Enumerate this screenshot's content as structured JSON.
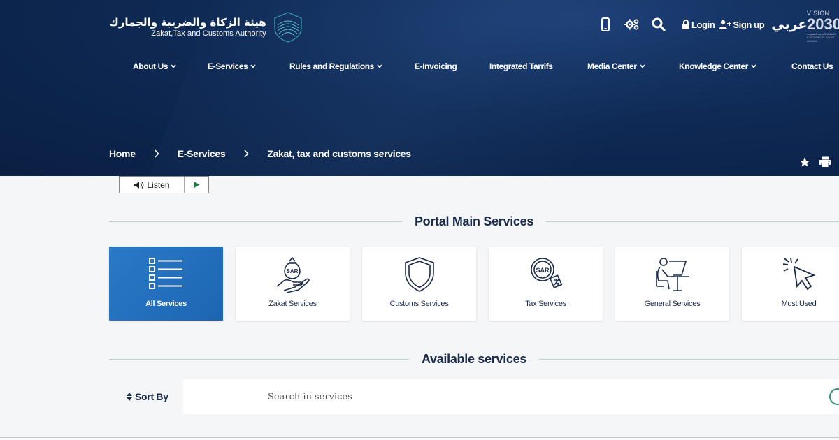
{
  "header": {
    "logo_ar": "هيئة الزكاة والضريبة والجمارك",
    "logo_en": "Zakat,Tax and Customs Authority",
    "login": "Login",
    "signup": "Sign up",
    "language": "عربي",
    "vision_label": "VISION",
    "vision_year": "2030",
    "vision_sub": "المملكة العربية السعودية",
    "vision_sub_en": "KINGDOM OF SAUDI ARABIA"
  },
  "nav": {
    "items": [
      {
        "label": "About Us",
        "dropdown": true
      },
      {
        "label": "E-Services",
        "dropdown": true
      },
      {
        "label": "Rules and Regulations",
        "dropdown": true
      },
      {
        "label": "E-Invoicing",
        "dropdown": false
      },
      {
        "label": "Integrated Tarrifs",
        "dropdown": false
      },
      {
        "label": "Media Center",
        "dropdown": true
      },
      {
        "label": "Knowledge Center",
        "dropdown": true
      },
      {
        "label": "Contact Us",
        "dropdown": false
      }
    ]
  },
  "breadcrumb": [
    "Home",
    "E-Services",
    "Zakat, tax and customs services"
  ],
  "listen": {
    "label": "Listen"
  },
  "portal": {
    "title": "Portal Main Services",
    "cards": [
      {
        "label": "All Services",
        "icon": "list-icon",
        "active": true
      },
      {
        "label": "Zakat Services",
        "icon": "hand-money-bag-icon",
        "active": false
      },
      {
        "label": "Customs Services",
        "icon": "shield-icon",
        "active": false
      },
      {
        "label": "Tax Services",
        "icon": "sar-percent-icon",
        "active": false
      },
      {
        "label": "General Services",
        "icon": "person-desk-icon",
        "active": false
      },
      {
        "label": "Most Used",
        "icon": "cursor-click-icon",
        "active": false
      }
    ]
  },
  "available": {
    "title": "Available services",
    "sort_label": "Sort By",
    "search_placeholder": "Search in services"
  },
  "colors": {
    "hero": "#0f2a55",
    "active_card": "#1d65b2",
    "divider": "#b9d1cc",
    "text_dark": "#1a2b4a"
  }
}
